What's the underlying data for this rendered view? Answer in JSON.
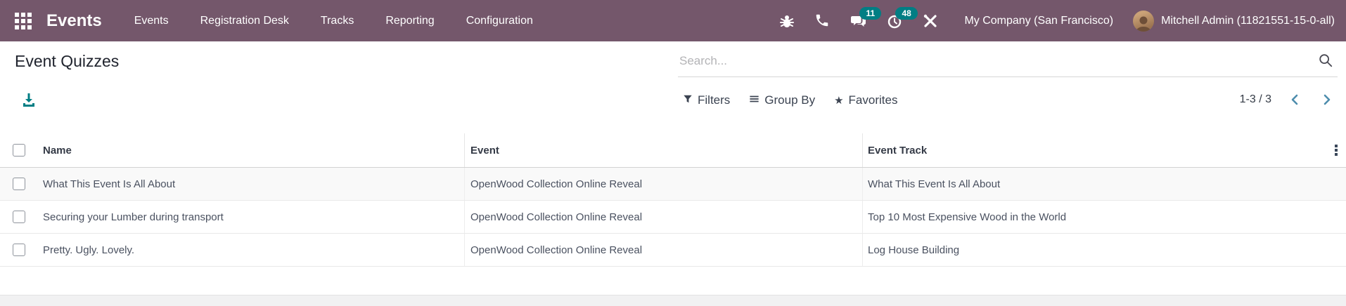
{
  "topbar": {
    "brand": "Events",
    "menu": [
      "Events",
      "Registration Desk",
      "Tracks",
      "Reporting",
      "Configuration"
    ],
    "badges": {
      "messages": "11",
      "activities": "48"
    },
    "company": "My Company (San Francisco)",
    "user": "Mitchell Admin (11821551-15-0-all)"
  },
  "control_panel": {
    "title": "Event Quizzes",
    "search_placeholder": "Search...",
    "filters_label": "Filters",
    "group_by_label": "Group By",
    "favorites_label": "Favorites",
    "pager_value": "1-3 / 3"
  },
  "table": {
    "columns": [
      "Name",
      "Event",
      "Event Track"
    ],
    "rows": [
      {
        "name": "What This Event Is All About",
        "event": "OpenWood Collection Online Reveal",
        "track": "What This Event Is All About"
      },
      {
        "name": "Securing your Lumber during transport",
        "event": "OpenWood Collection Online Reveal",
        "track": "Top 10 Most Expensive Wood in the World"
      },
      {
        "name": "Pretty. Ugly. Lovely.",
        "event": "OpenWood Collection Online Reveal",
        "track": "Log House Building"
      }
    ]
  },
  "colors": {
    "topbar_background": "#74576b",
    "badge_teal": "#017e84",
    "export_icon_teal": "#017e84",
    "pager_chevron_blue": "#4e8dad"
  }
}
